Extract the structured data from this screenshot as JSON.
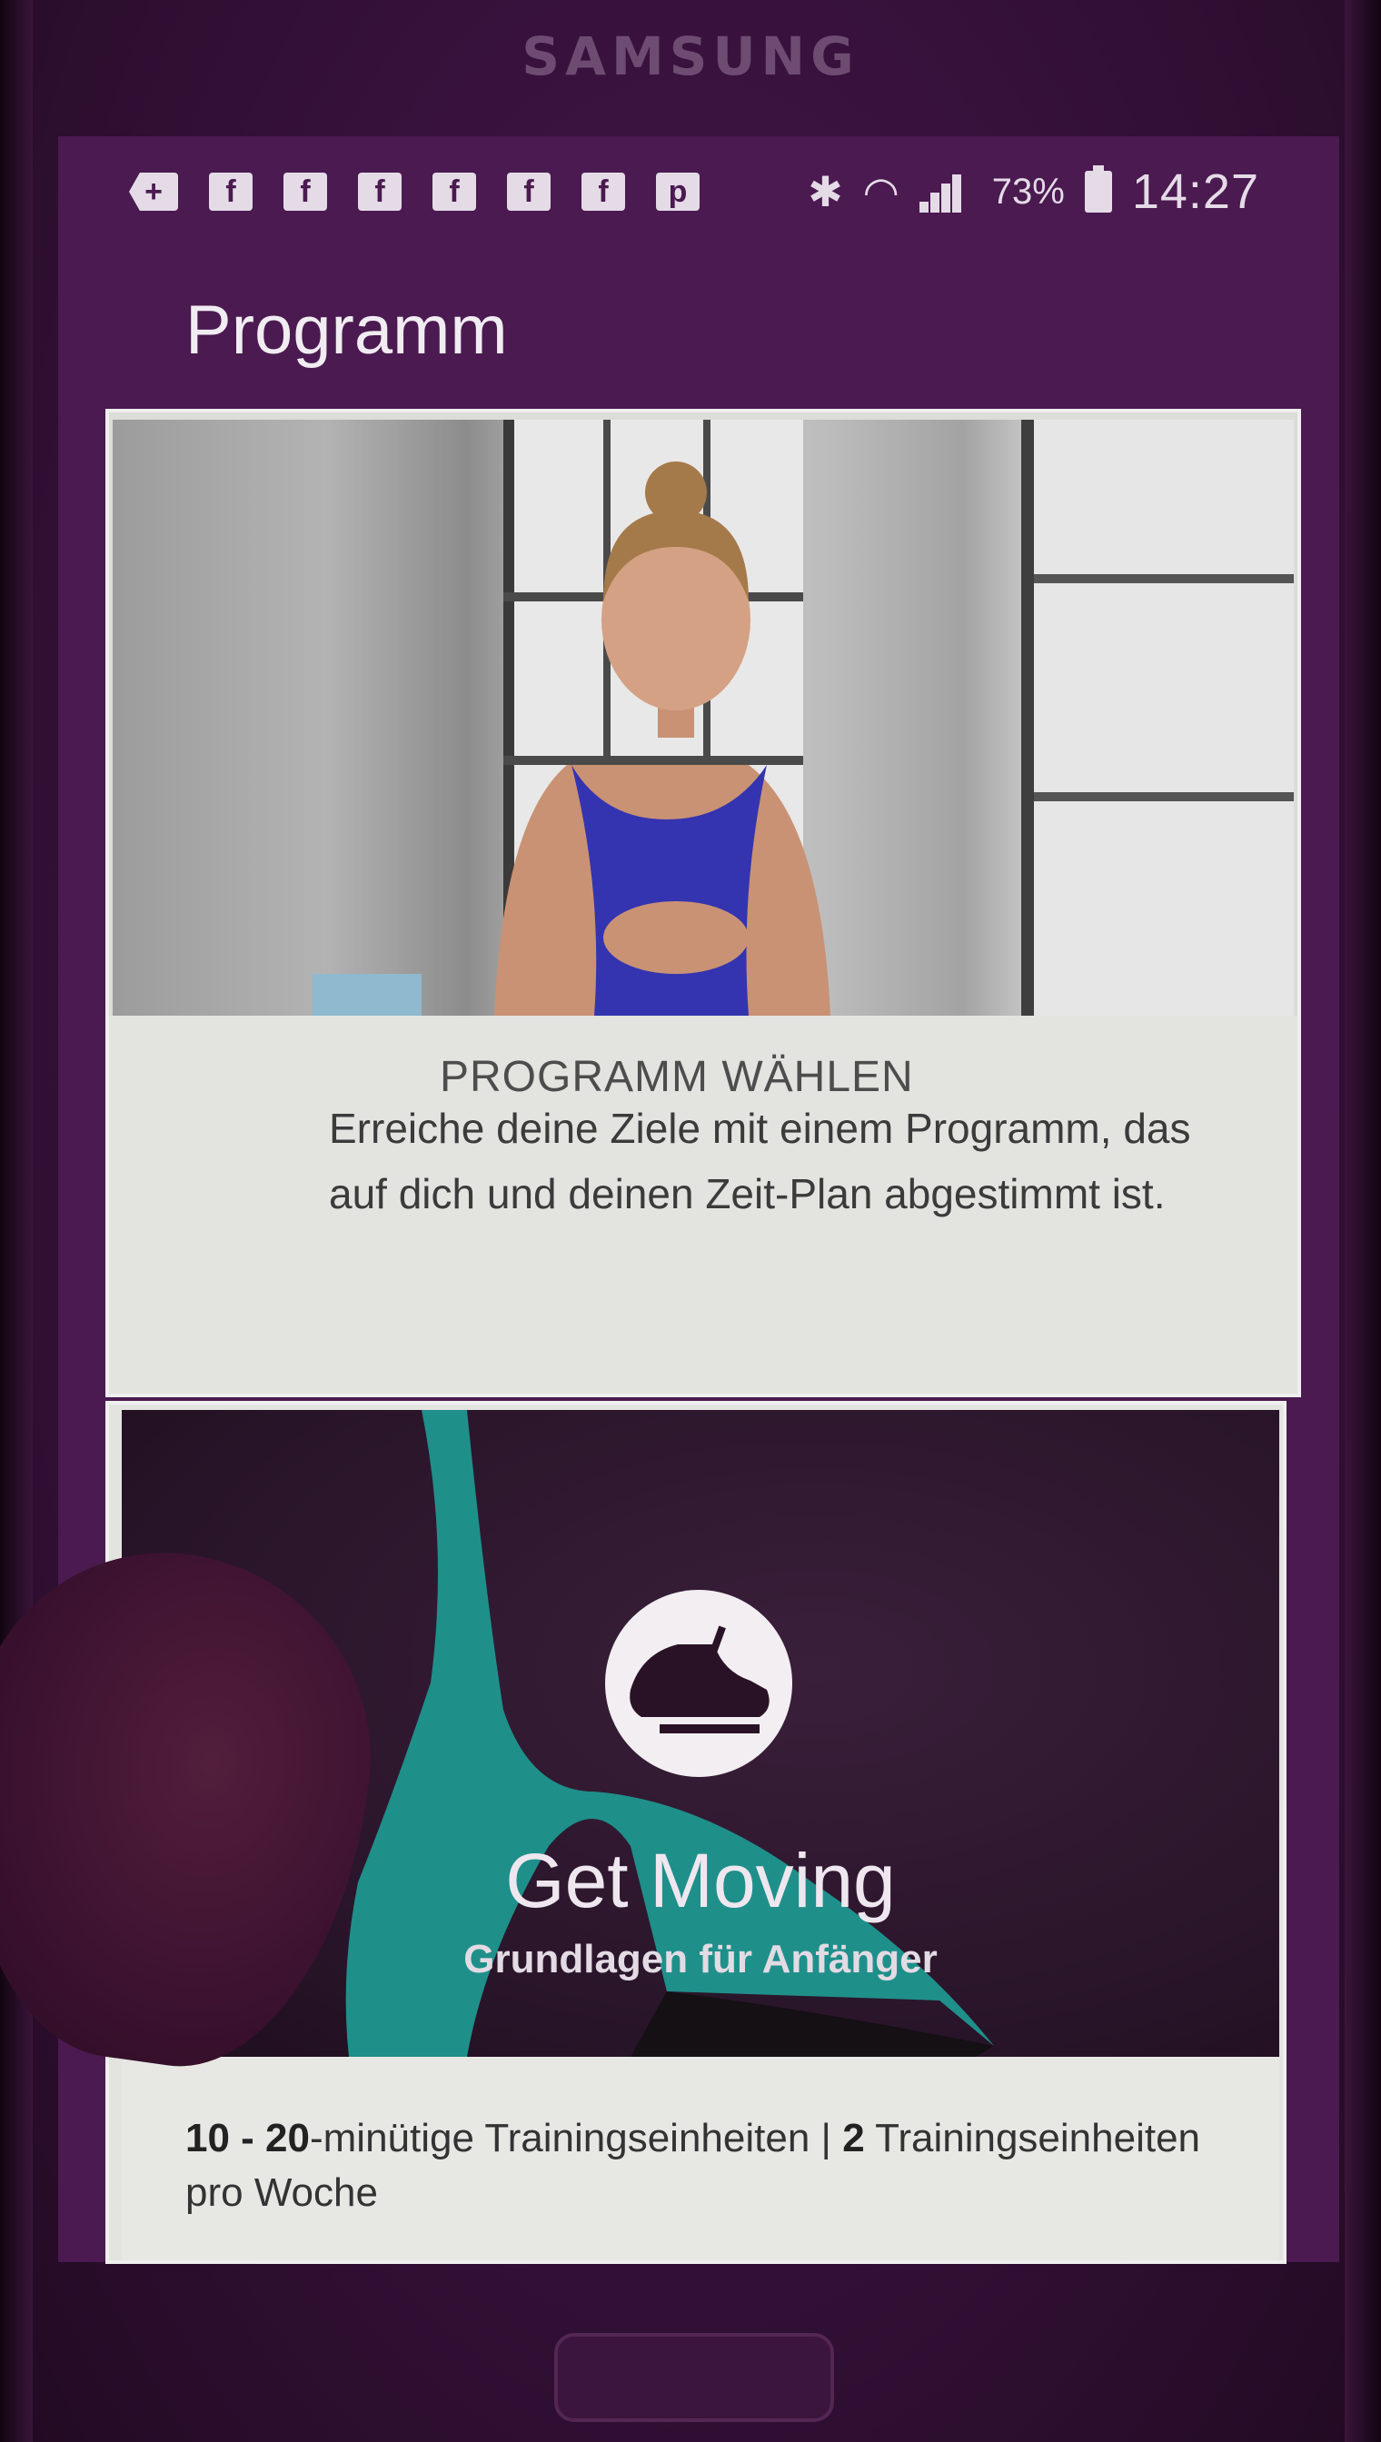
{
  "device": {
    "brand": "SAMSUNG"
  },
  "status_bar": {
    "notification_icons": [
      "back-plus",
      "facebook",
      "facebook",
      "facebook",
      "facebook",
      "facebook",
      "facebook",
      "p-app"
    ],
    "bluetooth_icon": "bluetooth-icon",
    "wifi_icon": "wifi-icon",
    "signal_icon": "signal-icon",
    "battery_percent": "73%",
    "time": "14:27"
  },
  "app_bar": {
    "title": "Programm"
  },
  "card_choose_program": {
    "heading": "PROGRAMM WÄHLEN",
    "description": "Erreiche deine Ziele mit einem Programm, das auf dich und deinen Zeit-Plan abgestimmt ist."
  },
  "card_program": {
    "icon": "running-shoe-icon",
    "title": "Get Moving",
    "subtitle": "Grundlagen für Anfänger",
    "info_bold_1": "10 - 20",
    "info_text_1": "-minütige Trainingseinheiten | ",
    "info_bold_2": "2",
    "info_text_2": " Trainingseinheiten pro Woche"
  },
  "colors": {
    "app_bar_bg": "#4a1a50",
    "card_bg": "#e3e4e0",
    "hero_bg": "#281428",
    "text_light": "#f1ecf2"
  }
}
